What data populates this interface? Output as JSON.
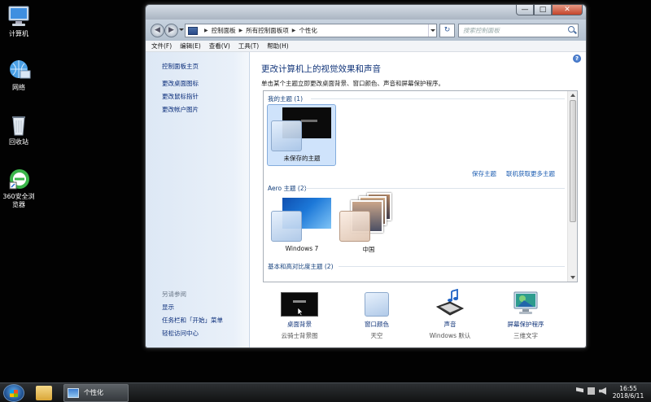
{
  "desktop": {
    "icons": [
      {
        "label": "计算机",
        "icon": "computer-icon"
      },
      {
        "label": "网络",
        "icon": "network-icon"
      },
      {
        "label": "回收站",
        "icon": "recycle-bin-icon"
      },
      {
        "label": "360安全浏览器",
        "icon": "browser-icon"
      }
    ]
  },
  "window": {
    "buttons": {
      "minimize": "—",
      "maximize": "□",
      "close": "✕"
    },
    "address": {
      "crumbs": [
        "控制面板",
        "所有控制面板项",
        "个性化"
      ],
      "refresh": "↻",
      "search_placeholder": "搜索控制面板"
    },
    "menu": [
      "文件(F)",
      "编辑(E)",
      "查看(V)",
      "工具(T)",
      "帮助(H)"
    ],
    "left_pane": {
      "home": "控制面板主页",
      "links": [
        "更改桌面图标",
        "更改鼠标指针",
        "更改帐户图片"
      ],
      "see_also_title": "另请参阅",
      "see_also": [
        "显示",
        "任务栏和「开始」菜单",
        "轻松访问中心"
      ]
    },
    "help": "?",
    "heading": "更改计算机上的视觉效果和声音",
    "subheading": "单击某个主题立即更改桌面背景、窗口颜色、声音和屏幕保护程序。",
    "themes": {
      "my_group": "我的主题 (1)",
      "my_theme_label": "未保存的主题",
      "save_link": "保存主题",
      "online_link": "联机获取更多主题",
      "aero_group": "Aero 主题 (2)",
      "aero": [
        "Windows 7",
        "中国"
      ],
      "basic_group": "基本和高对比度主题 (2)"
    },
    "actions": [
      {
        "title": "桌面背景",
        "subtitle": "云骑士背景图",
        "icon": "desktop-background-icon"
      },
      {
        "title": "窗口颜色",
        "subtitle": "天空",
        "icon": "window-color-icon"
      },
      {
        "title": "声音",
        "subtitle": "Windows 默认",
        "icon": "sound-icon"
      },
      {
        "title": "屏幕保护程序",
        "subtitle": "三维文字",
        "icon": "screensaver-icon"
      }
    ]
  },
  "taskbar": {
    "task_label": "个性化",
    "time": "16:55",
    "date": "2018/6/11"
  },
  "colors": {
    "link_blue": "#0a2d7a",
    "heading_blue": "#12357a",
    "selection": "#cfe3fb",
    "desktop": "#020202"
  }
}
